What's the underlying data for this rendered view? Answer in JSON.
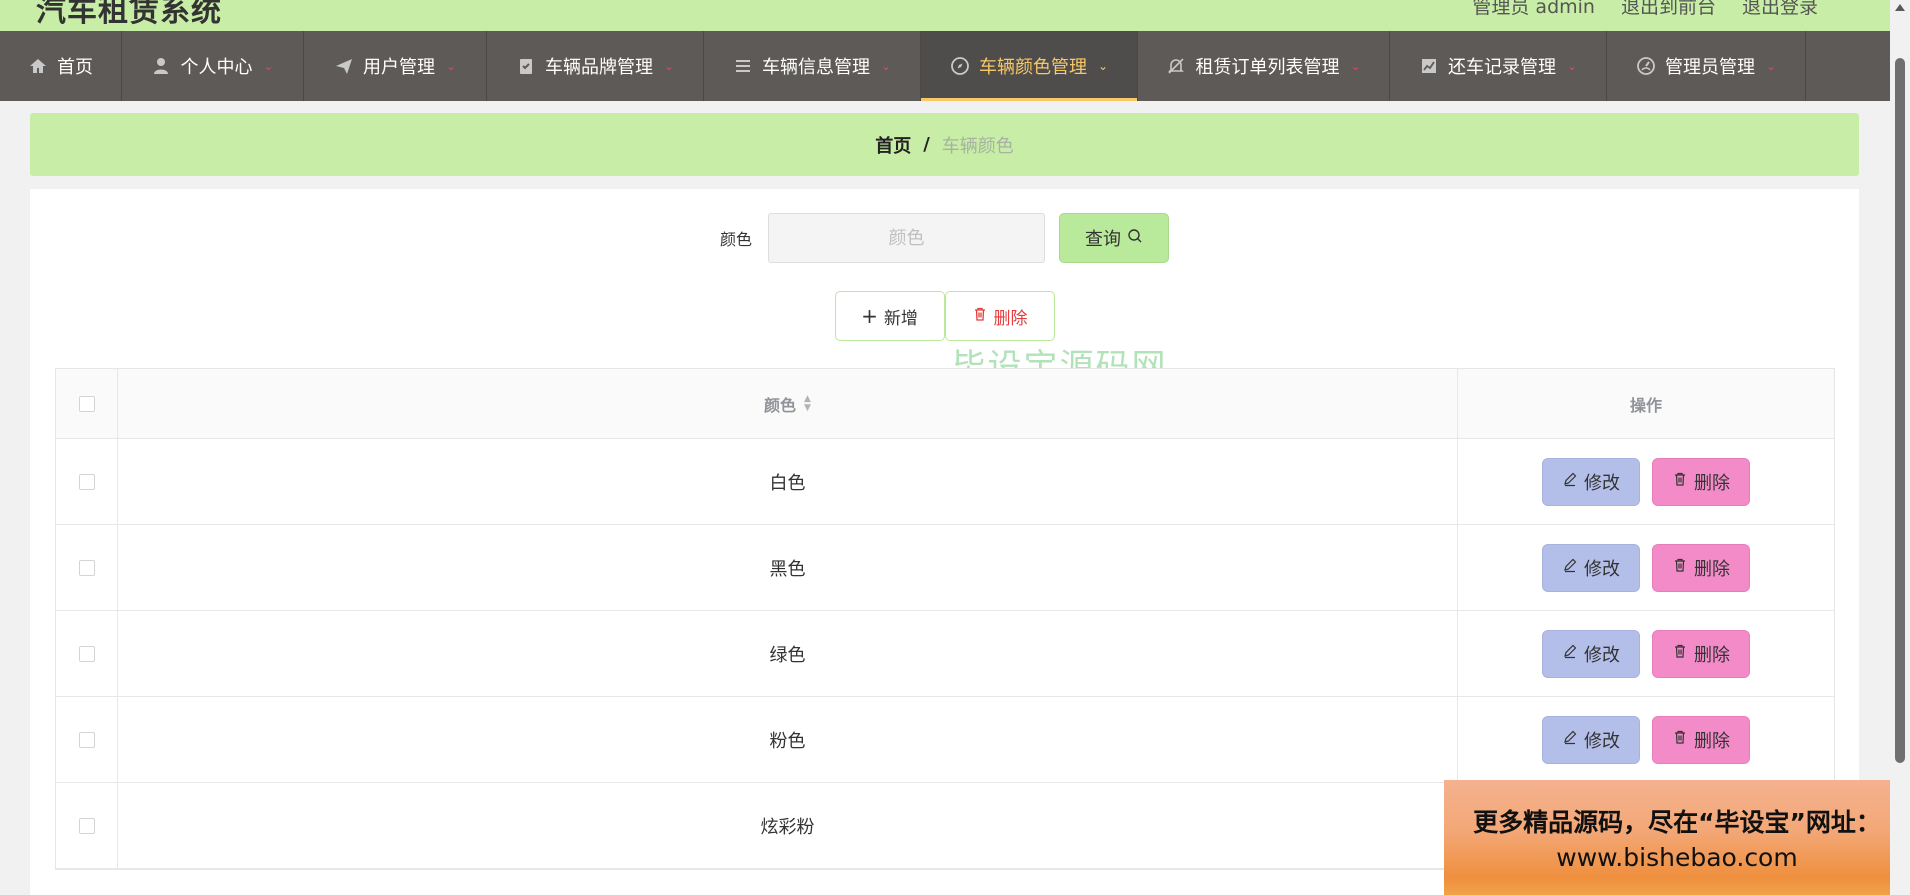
{
  "header": {
    "title": "汽车租赁系统",
    "user_text": "管理员 admin",
    "goto_front": "退出到前台",
    "logout": "退出登录"
  },
  "nav": {
    "items": [
      {
        "label": "首页",
        "icon": "home-icon"
      },
      {
        "label": "个人中心",
        "icon": "user-icon"
      },
      {
        "label": "用户管理",
        "icon": "send-icon"
      },
      {
        "label": "车辆品牌管理",
        "icon": "clipboard-icon"
      },
      {
        "label": "车辆信息管理",
        "icon": "list-icon"
      },
      {
        "label": "车辆颜色管理",
        "icon": "compass-icon",
        "active": true
      },
      {
        "label": "租赁订单列表管理",
        "icon": "bell-off-icon"
      },
      {
        "label": "还车记录管理",
        "icon": "chart-icon"
      },
      {
        "label": "管理员管理",
        "icon": "gauge-icon"
      }
    ]
  },
  "breadcrumb": {
    "home": "首页",
    "separator": "/",
    "current": "车辆颜色"
  },
  "search": {
    "label": "颜色",
    "placeholder": "颜色",
    "query_button": "查询"
  },
  "actions": {
    "add_button": "新增",
    "delete_button": "删除"
  },
  "watermark": {
    "cn": "毕设宝源码网",
    "en": "bishebao.com"
  },
  "table": {
    "columns": {
      "color": "颜色",
      "ops": "操作"
    },
    "rows": [
      {
        "color": "白色"
      },
      {
        "color": "黑色"
      },
      {
        "color": "绿色"
      },
      {
        "color": "粉色"
      },
      {
        "color": "炫彩粉"
      }
    ],
    "edit_label": "修改",
    "delete_label": "删除"
  },
  "ad": {
    "line1": "更多精品源码，尽在“毕设宝”网址：",
    "line2": "www.bishebao.com"
  },
  "colors": {
    "accent_green": "#c8eda6",
    "nav_bg": "#5d5a57",
    "active_text": "#f6c86a",
    "edit_btn": "#b4bfe9",
    "delete_btn": "#f38bc9"
  }
}
